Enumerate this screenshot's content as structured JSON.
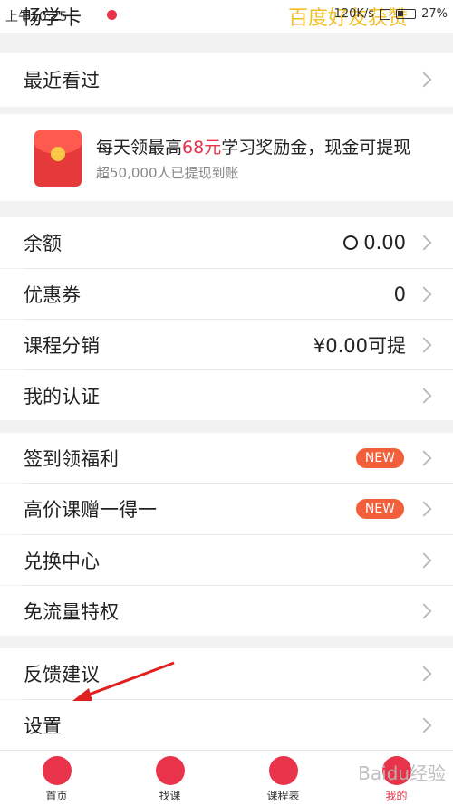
{
  "status_bar": {
    "time": "上午10:25",
    "carrier": "畅学卡",
    "network_speed": "120K/s",
    "battery": "27%",
    "overlay_text": "百度好友获赞"
  },
  "menu": {
    "recent": "最近看过",
    "balance_label": "余额",
    "balance_value": "0.00",
    "coupons_label": "优惠券",
    "coupons_value": "0",
    "distribution_label": "课程分销",
    "distribution_value": "¥0.00可提",
    "verify_label": "我的认证",
    "signin_label": "签到领福利",
    "gift_label": "高价课赠一得一",
    "exchange_label": "兑换中心",
    "freeflow_label": "免流量特权",
    "feedback_label": "反馈建议",
    "settings_label": "设置",
    "new_badge": "NEW"
  },
  "promo": {
    "title_prefix": "每天领最高",
    "title_highlight": "68元",
    "title_suffix": "学习奖励金，现金可提现",
    "subtitle": "超50,000人已提现到账"
  },
  "tabs": [
    {
      "label": "首页",
      "icon": "home-icon"
    },
    {
      "label": "找课",
      "icon": "find-course-icon"
    },
    {
      "label": "课程表",
      "icon": "schedule-icon"
    },
    {
      "label": "我的",
      "icon": "profile-icon"
    }
  ],
  "watermark": "Baidu经验",
  "colors": {
    "accent": "#e8334a",
    "badge": "#f2603b"
  }
}
